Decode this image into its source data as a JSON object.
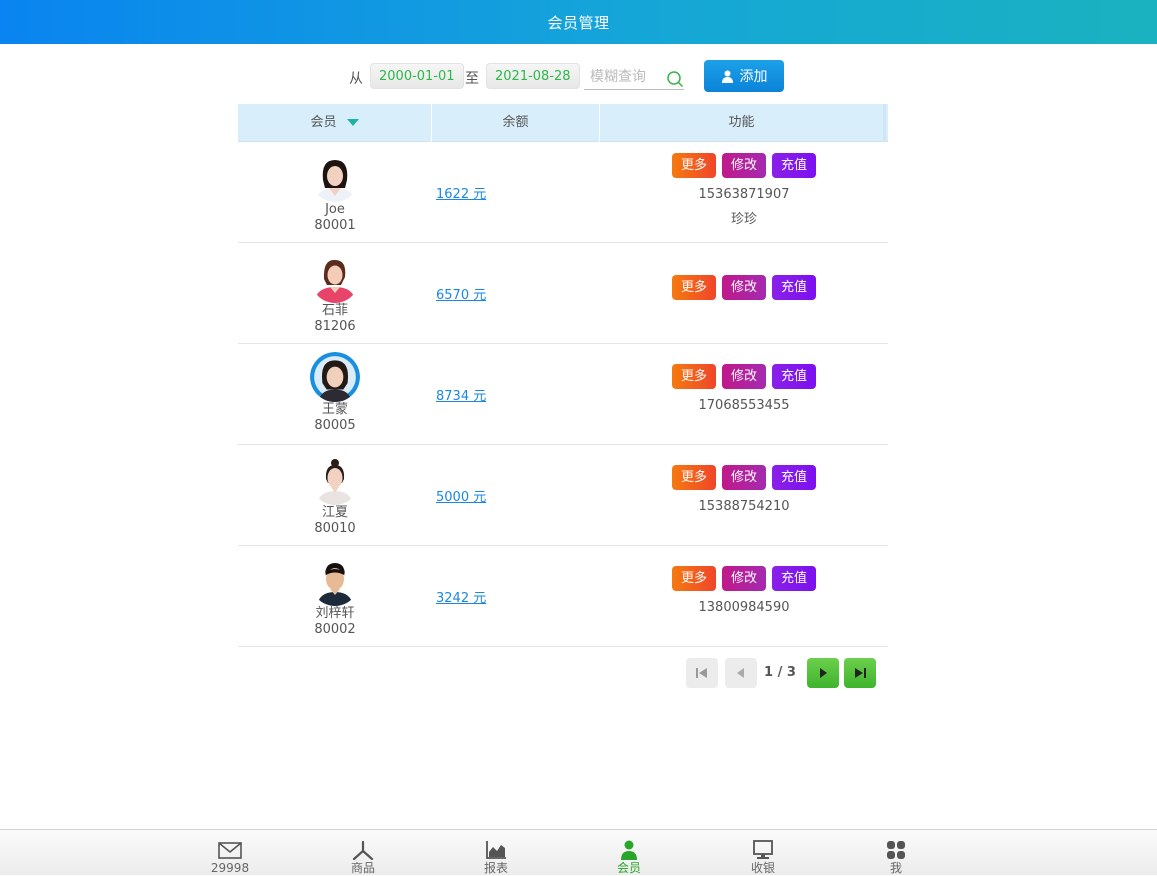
{
  "header": {
    "title": "会员管理"
  },
  "filter": {
    "from_label": "从",
    "start_date": "2000-01-01",
    "to_label": "至",
    "end_date": "2021-08-28",
    "search_placeholder": "模糊查询",
    "add_label": "添加"
  },
  "table": {
    "columns": [
      "会员",
      "余额",
      "功能"
    ],
    "actions": {
      "more": "更多",
      "edit": "修改",
      "charge": "充值"
    },
    "rows": [
      {
        "name": "Joe",
        "id": "80001",
        "balance": "1622 元",
        "phone": "15363871907",
        "nickname": "珍珍",
        "avatar": "female-avatar-1"
      },
      {
        "name": "石菲",
        "id": "81206",
        "balance": "6570 元",
        "phone": "",
        "nickname": "",
        "avatar": "female-avatar-2"
      },
      {
        "name": "王蒙",
        "id": "80005",
        "balance": "8734 元",
        "phone": "17068553455",
        "nickname": "",
        "avatar": "female-avatar-3"
      },
      {
        "name": "江夏",
        "id": "80010",
        "balance": "5000 元",
        "phone": "15388754210",
        "nickname": "",
        "avatar": "female-avatar-4"
      },
      {
        "name": "刘梓轩",
        "id": "80002",
        "balance": "3242 元",
        "phone": "13800984590",
        "nickname": "",
        "avatar": "male-avatar-1"
      }
    ]
  },
  "pagination": {
    "text": "1 / 3",
    "current": 1,
    "total": 3
  },
  "bottom_nav": {
    "items": [
      {
        "label": "29998",
        "icon": "mail-icon",
        "active": false
      },
      {
        "label": "商品",
        "icon": "goods-icon",
        "active": false
      },
      {
        "label": "报表",
        "icon": "chart-icon",
        "active": false
      },
      {
        "label": "会员",
        "icon": "member-icon",
        "active": true
      },
      {
        "label": "收银",
        "icon": "monitor-icon",
        "active": false
      },
      {
        "label": "我",
        "icon": "grid-icon",
        "active": false
      }
    ]
  },
  "colors": {
    "header_start": "#0a84f0",
    "header_end": "#1ab2c0",
    "date_text": "#2db84a",
    "link": "#1a87e6",
    "btn_more": "#f0452a",
    "btn_edit": "#a42ab0",
    "btn_charge": "#7c10f0",
    "active_nav": "#2aa52a"
  }
}
